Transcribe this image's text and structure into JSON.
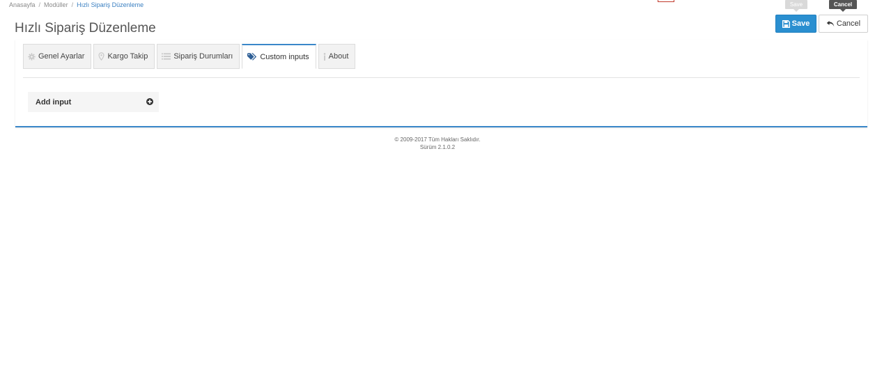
{
  "breadcrumb": {
    "items": [
      "Anasayfa",
      "Modüller",
      "Hızlı Sipariş Düzenleme"
    ],
    "separator": "/"
  },
  "page": {
    "title": "Hızlı Sipariş Düzenleme"
  },
  "toolbar": {
    "save_label": "Save",
    "cancel_label": "Cancel",
    "save_tooltip": "Save",
    "cancel_tooltip": "Cancel",
    "save_icon": "floppy-disk-icon",
    "cancel_icon": "undo-arrow-icon"
  },
  "tabs": [
    {
      "label": "Genel Ayarlar",
      "icon": "gear-icon",
      "active": false
    },
    {
      "label": "Kargo Takip",
      "icon": "map-pin-icon",
      "active": false
    },
    {
      "label": "Sipariş Durumları",
      "icon": "list-icon",
      "active": false
    },
    {
      "label": "Custom inputs",
      "icon": "tags-icon",
      "active": true
    },
    {
      "label": "About",
      "icon": "info-icon",
      "active": false
    }
  ],
  "custom_inputs": {
    "add_label": "Add input",
    "add_icon": "plus-circle-icon"
  },
  "footer": {
    "copyright": "© 2009-2017 Tüm Hakları Saklıdır.",
    "version": "Sürüm 2.1.0.2"
  },
  "colors": {
    "accent": "#2a8fd0",
    "tab_active_border": "#3a87c9",
    "breadcrumb_current": "#3a7fc1"
  }
}
